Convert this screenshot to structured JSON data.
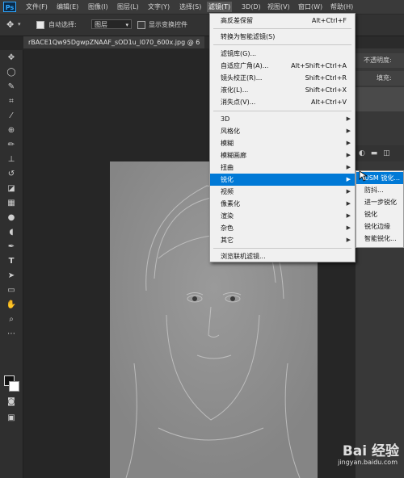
{
  "app": {
    "logo": "Ps"
  },
  "menubar": {
    "items": [
      "文件(F)",
      "编辑(E)",
      "图像(I)",
      "图层(L)",
      "文字(Y)",
      "选择(S)",
      "滤镜(T)",
      "3D(D)",
      "视图(V)",
      "窗口(W)",
      "帮助(H)"
    ],
    "active_index": 6
  },
  "options": {
    "auto_select_label": "自动选择:",
    "auto_select_checked": true,
    "layer_select_value": "图层",
    "show_transform_label": "显示变换控件"
  },
  "document": {
    "tab_title": "rBACE1Qw95DgwpZNAAF_sOD1u_l070_600x.jpg @ 6"
  },
  "right_panel": {
    "opacity_label": "不透明度:",
    "fill_label": "填充:"
  },
  "filter_menu": {
    "items": [
      {
        "label": "高反差保留",
        "shortcut": "Alt+Ctrl+F"
      },
      {
        "label": "转换为智能滤镜(S)",
        "shortcut": ""
      },
      {
        "label": "滤镜库(G)...",
        "shortcut": ""
      },
      {
        "label": "自适应广角(A)...",
        "shortcut": "Alt+Shift+Ctrl+A"
      },
      {
        "label": "镜头校正(R)...",
        "shortcut": "Shift+Ctrl+R"
      },
      {
        "label": "液化(L)...",
        "shortcut": "Shift+Ctrl+X"
      },
      {
        "label": "消失点(V)...",
        "shortcut": "Alt+Ctrl+V"
      },
      {
        "label": "3D",
        "submenu": true
      },
      {
        "label": "风格化",
        "submenu": true
      },
      {
        "label": "模糊",
        "submenu": true
      },
      {
        "label": "模糊画廊",
        "submenu": true
      },
      {
        "label": "扭曲",
        "submenu": true
      },
      {
        "label": "锐化",
        "submenu": true,
        "highlighted": true
      },
      {
        "label": "视频",
        "submenu": true
      },
      {
        "label": "像素化",
        "submenu": true
      },
      {
        "label": "渲染",
        "submenu": true
      },
      {
        "label": "杂色",
        "submenu": true
      },
      {
        "label": "其它",
        "submenu": true
      },
      {
        "label": "浏览联机滤镜...",
        "shortcut": ""
      }
    ]
  },
  "sharpen_submenu": {
    "items": [
      "USM 锐化...",
      "防抖...",
      "进一步锐化",
      "锐化",
      "锐化边缘",
      "智能锐化..."
    ],
    "highlighted_index": 0
  },
  "watermark": {
    "main": "Bai 经验",
    "sub": "jingyan.baidu.com"
  },
  "colors": {
    "menu_highlight": "#0079d6",
    "ps_blue": "#31a8ff"
  }
}
